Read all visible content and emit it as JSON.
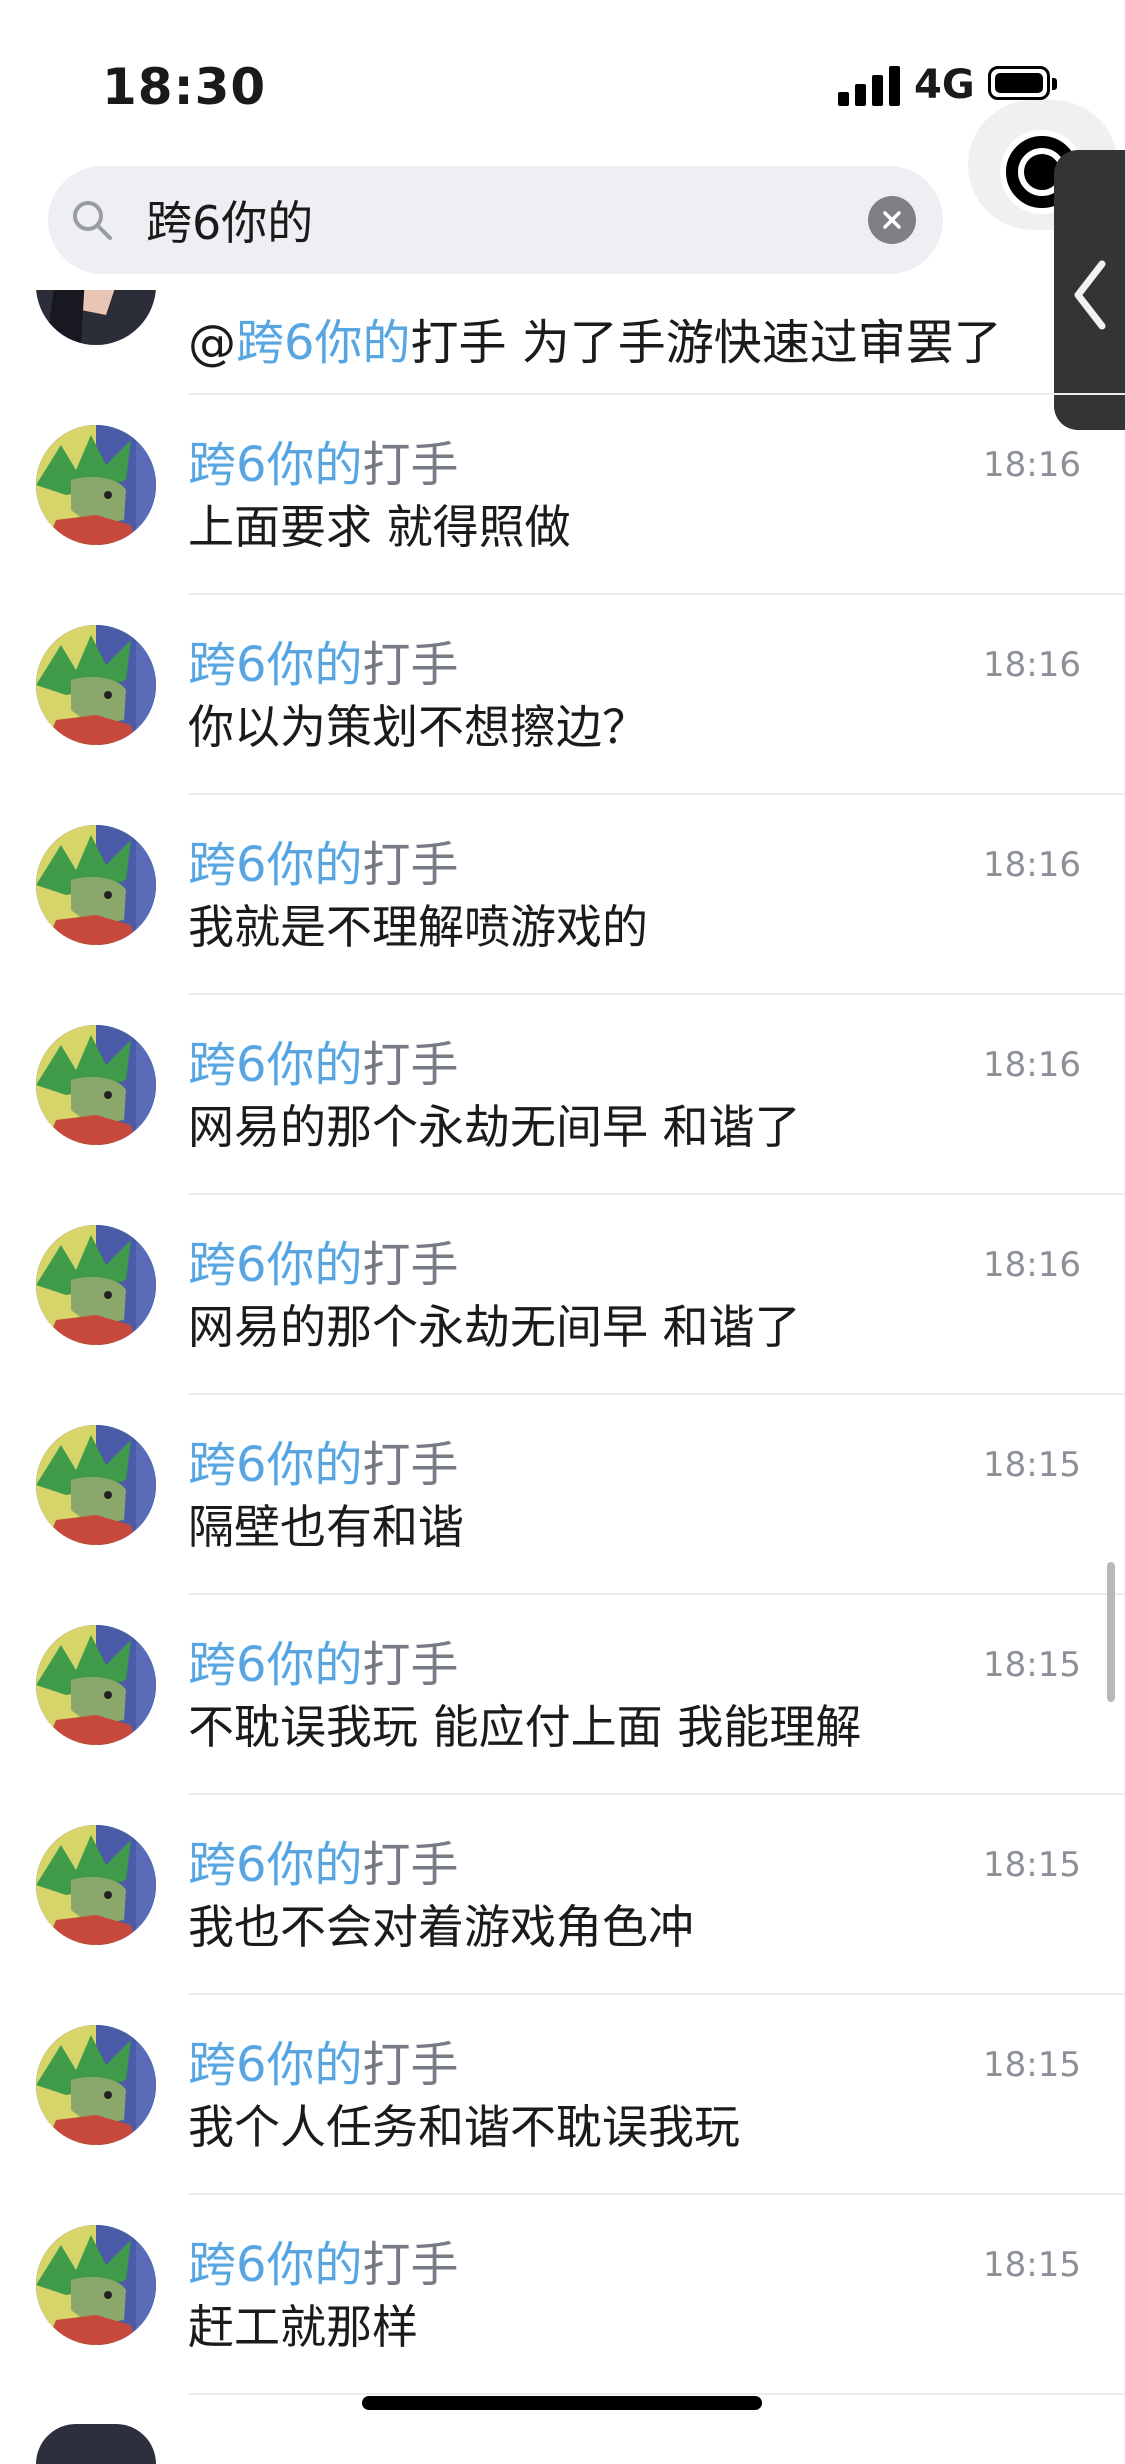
{
  "status_bar": {
    "time": "18:30",
    "network": "4G",
    "battery_level": 0.9
  },
  "search": {
    "query": "跨6你的",
    "search_icon": "search-icon",
    "clear_icon": "clear-icon"
  },
  "side_panel": {
    "camera_icon": "camera-icon",
    "handle_icon": "chevron-left-icon"
  },
  "partial_message": {
    "prefix": "@",
    "highlight": "跨6你的",
    "rest": "打手 为了手游快速过审罢了"
  },
  "messages": [
    {
      "name_highlight": "跨6你的",
      "name_rest": "打手",
      "time": "18:16",
      "text": "上面要求 就得照做"
    },
    {
      "name_highlight": "跨6你的",
      "name_rest": "打手",
      "time": "18:16",
      "text": "你以为策划不想擦边？"
    },
    {
      "name_highlight": "跨6你的",
      "name_rest": "打手",
      "time": "18:16",
      "text": "我就是不理解喷游戏的"
    },
    {
      "name_highlight": "跨6你的",
      "name_rest": "打手",
      "time": "18:16",
      "text": "网易的那个永劫无间早 和谐了"
    },
    {
      "name_highlight": "跨6你的",
      "name_rest": "打手",
      "time": "18:16",
      "text": "网易的那个永劫无间早 和谐了"
    },
    {
      "name_highlight": "跨6你的",
      "name_rest": "打手",
      "time": "18:15",
      "text": "隔壁也有和谐"
    },
    {
      "name_highlight": "跨6你的",
      "name_rest": "打手",
      "time": "18:15",
      "text": "不耽误我玩 能应付上面 我能理解"
    },
    {
      "name_highlight": "跨6你的",
      "name_rest": "打手",
      "time": "18:15",
      "text": "我也不会对着游戏角色冲"
    },
    {
      "name_highlight": "跨6你的",
      "name_rest": "打手",
      "time": "18:15",
      "text": "我个人任务和谐不耽误我玩"
    },
    {
      "name_highlight": "跨6你的",
      "name_rest": "打手",
      "time": "18:15",
      "text": "赶工就那样"
    }
  ],
  "colors": {
    "highlight": "#57a6e2",
    "name_gray": "#777b85",
    "time_gray": "#8c9099",
    "search_bg": "#eeeff3"
  }
}
